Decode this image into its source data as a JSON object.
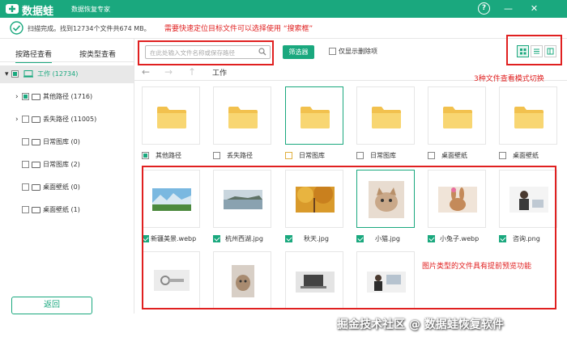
{
  "app": {
    "name": "数据蛙",
    "subtitle": "数据恢复专家",
    "help": "?",
    "minimize": "—",
    "close": "✕"
  },
  "status": {
    "text": "扫描完成。找到12734个文件共674 MB。"
  },
  "annotations": {
    "search_hint": "需要快速定位目标文件可以选择使用 “搜索框”",
    "view_modes": "3种文件查看模式切换",
    "image_preview": "图片类型的文件具有提前预览功能"
  },
  "left_panel": {
    "tab_path": "按路径查看",
    "tab_type": "按类型查看",
    "tree": [
      {
        "label": "工作 (12734)",
        "level": 0
      },
      {
        "label": "其他路径 (1716)",
        "level": 1
      },
      {
        "label": "丢失路径 (11005)",
        "level": 1
      },
      {
        "label": "日常图库 (0)",
        "level": 1
      },
      {
        "label": "日常图库 (2)",
        "level": 1
      },
      {
        "label": "桌面壁纸 (0)",
        "level": 1
      },
      {
        "label": "桌面壁纸 (1)",
        "level": 1
      }
    ],
    "back_button": "返回"
  },
  "toolbar": {
    "search_placeholder": "在此处输入文件名称或保存路径",
    "filter_button": "筛选器",
    "show_deleted": "仅显示删除项"
  },
  "nav": {
    "path": "工作"
  },
  "folders": [
    {
      "label": "其他路径",
      "checked": "partial"
    },
    {
      "label": "丢失路径",
      "checked": "none"
    },
    {
      "label": "日常图库",
      "checked": "none"
    },
    {
      "label": "日常图库",
      "checked": "none"
    },
    {
      "label": "桌面壁纸",
      "checked": "none"
    },
    {
      "label": "桌面壁纸",
      "checked": "none"
    }
  ],
  "images_row1": [
    {
      "label": "新疆美景.webp"
    },
    {
      "label": "杭州西湖.jpg"
    },
    {
      "label": "秋天.jpg"
    },
    {
      "label": "小猫.jpg"
    },
    {
      "label": "小兔子.webp"
    },
    {
      "label": "咨询.png"
    }
  ],
  "watermark": "掘金技术社区 @ 数据蛙恢复软件",
  "colors": {
    "brand": "#1aa87e",
    "annotation": "#e02020"
  }
}
